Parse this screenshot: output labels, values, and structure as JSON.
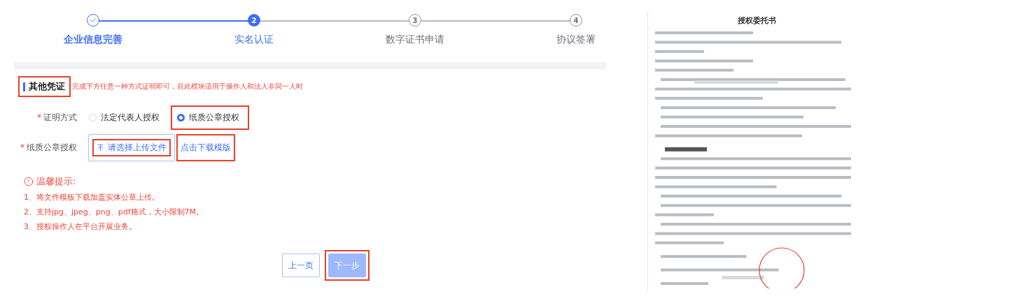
{
  "steps": [
    {
      "label": "企业信息完善",
      "completed": true,
      "current": false
    },
    {
      "number": "2",
      "label": "实名认证",
      "completed": false,
      "current": true
    },
    {
      "number": "3",
      "label": "数字证书申请",
      "completed": false,
      "current": false
    },
    {
      "number": "4",
      "label": "协议签署",
      "completed": false,
      "current": false
    }
  ],
  "section": {
    "title": "其他凭证",
    "highlighted": true,
    "note": "完成下方任意一种方式证明即可，且此模块适用于操作人和法人非同一人时"
  },
  "proof_row": {
    "mark": "*",
    "label": "证明方式",
    "options": [
      {
        "label": "法定代表人授权",
        "selected": false,
        "highlighted": false
      },
      {
        "label": "纸质公章授权",
        "selected": true,
        "highlighted": true
      }
    ]
  },
  "upload_row": {
    "mark": "*",
    "label": "纸质公章授权",
    "upload_button": {
      "label": "请选择上传文件",
      "highlighted": true
    },
    "download_link": {
      "label": "点击下载模版",
      "highlighted": true
    }
  },
  "tips": {
    "title": "温馨提示:",
    "items": [
      "1、将文件模板下载加盖实体公章上传。",
      "2、支持jpg、jpeg、png、pdf格式，大小限制7M。",
      "3、授权操作人在平台开展业务。"
    ]
  },
  "buttons": [
    {
      "label": "上一页",
      "kind": "outline",
      "highlighted": false
    },
    {
      "label": "下一步",
      "kind": "primary-disabled",
      "highlighted": true
    }
  ],
  "document": {
    "title": "授权委托书"
  }
}
